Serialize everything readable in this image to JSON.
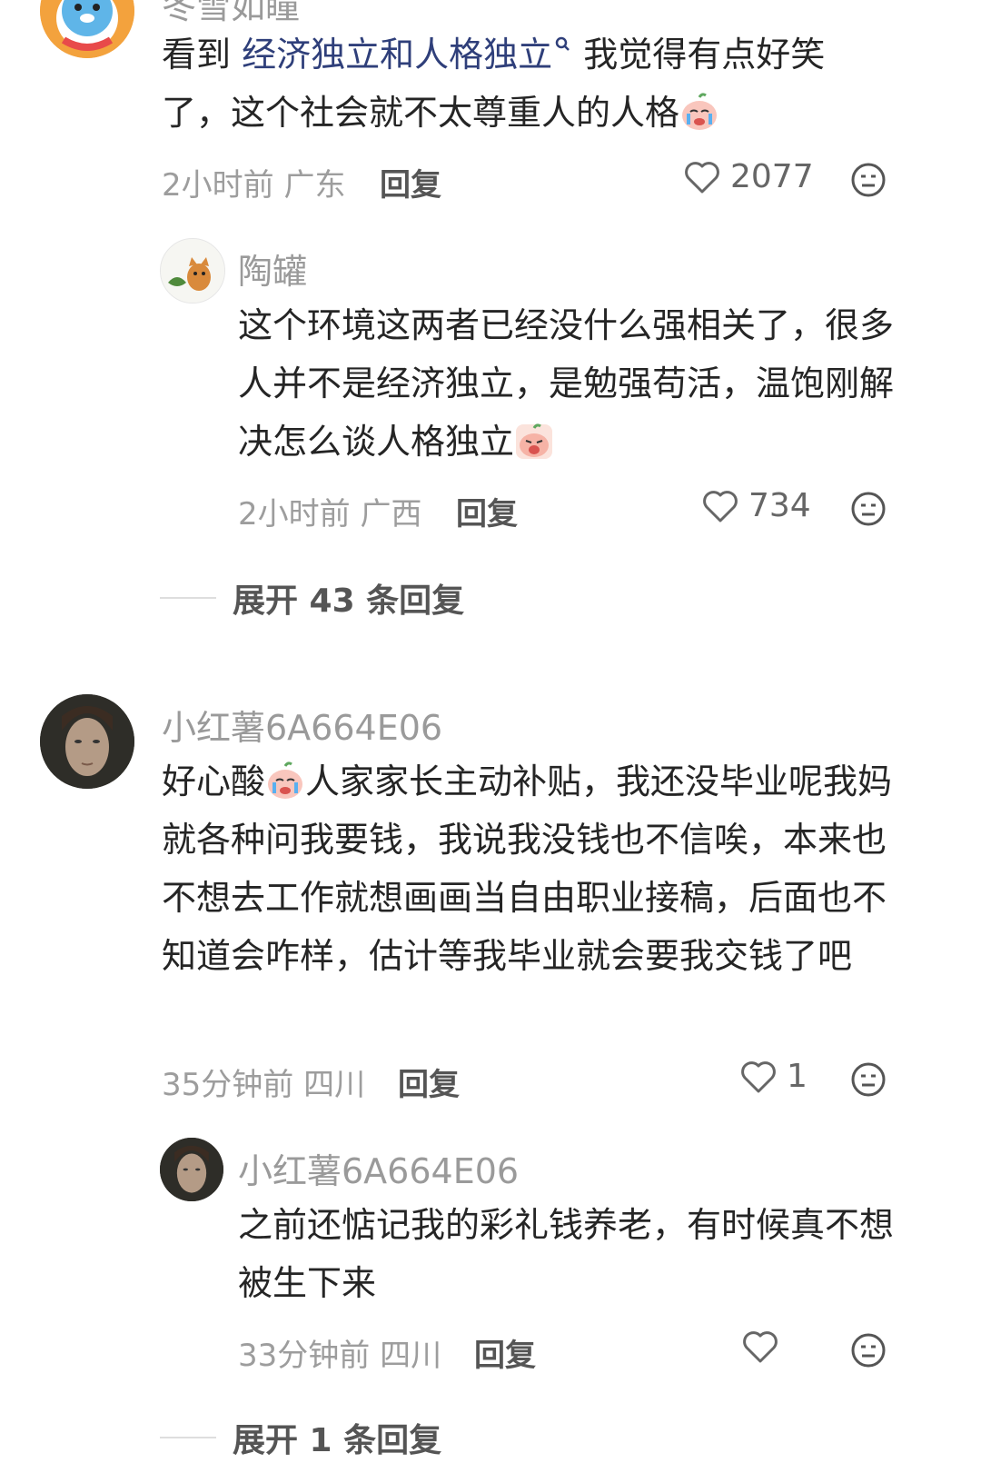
{
  "comments": [
    {
      "name": "冬雪如瞳",
      "text_prefix": "看到 ",
      "link": "经济独立和人格独立",
      "text_after_link": " 我觉得有点好笑了，这个社会就不太尊重人的人格",
      "time": "2小时前",
      "location": "广东",
      "reply_label": "回复",
      "likes": "2077",
      "avatar_icon": "cartoon-blue-creature-avatar",
      "reply": {
        "name": "陶罐",
        "text": "这个环境这两者已经没什么强相关了，很多人并不是经济独立，是勉强苟活，温饱刚解决怎么谈人格独立",
        "time": "2小时前",
        "location": "广西",
        "reply_label": "回复",
        "likes": "734",
        "avatar_icon": "cat-avatar"
      },
      "expand_label": "展开 43 条回复"
    },
    {
      "name": "小红薯6A664E06",
      "text_a": "好心酸",
      "text_b": "人家家长主动补贴，我还没毕业呢我妈就各种问我要钱，我说我没钱也不信唉，本来也不想去工作就想画画当自由职业接稿，后面也不知道会咋样，估计等我毕业就会要我交钱了吧",
      "time": "35分钟前",
      "location": "四川",
      "reply_label": "回复",
      "likes": "1",
      "avatar_icon": "woman-portrait-avatar",
      "reply": {
        "name": "小红薯6A664E06",
        "text": "之前还惦记我的彩礼钱养老，有时候真不想被生下来",
        "time": "33分钟前",
        "location": "四川",
        "reply_label": "回复",
        "avatar_icon": "woman-portrait-avatar"
      },
      "expand_label": "展开 1 条回复"
    }
  ],
  "colors": {
    "link": "#2f3f7a",
    "meta": "#9d9d9d",
    "body": "#252525",
    "divider": "#dedede"
  }
}
